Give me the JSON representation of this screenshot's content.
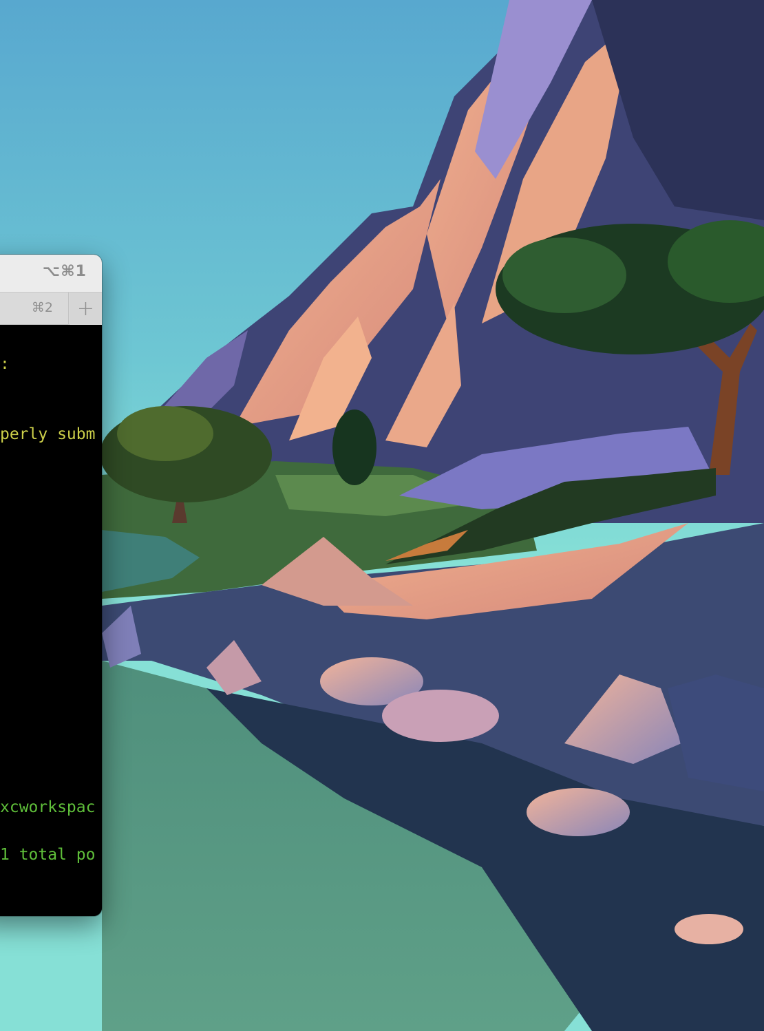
{
  "terminal": {
    "window_shortcut": "⌥⌘1",
    "tabs": [
      {
        "shortcut": "⌘2"
      }
    ],
    "new_tab_label": "+",
    "lines": [
      {
        "text": ":",
        "color": "yellow"
      },
      {
        "text": "perly subm",
        "color": "yellow"
      },
      {
        "text": "xcworkspac",
        "color": "green"
      },
      {
        "text": "1 total po",
        "color": "green"
      }
    ]
  },
  "colors": {
    "terminal_yellow": "#cdd04a",
    "terminal_green": "#5fbf3a",
    "terminal_bg": "#000000",
    "titlebar_bg": "#ececec"
  }
}
